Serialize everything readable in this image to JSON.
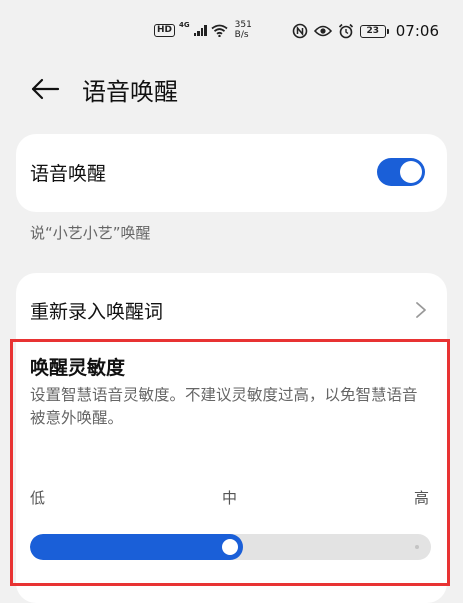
{
  "status_bar": {
    "hd": "HD",
    "network": "4G",
    "speed_value": "351",
    "speed_unit": "B/s",
    "battery": "23",
    "time": "07:06"
  },
  "header": {
    "title": "语音唤醒"
  },
  "voice_wake": {
    "label": "语音唤醒",
    "enabled": true
  },
  "caption": "说“小艺小艺”唤醒",
  "settings": {
    "re_enroll_label": "重新录入唤醒词",
    "sensitivity": {
      "title": "唤醒灵敏度",
      "description": "设置智慧语音灵敏度。不建议灵敏度过高，以免智慧语音被意外唤醒。",
      "low_label": "低",
      "mid_label": "中",
      "high_label": "高",
      "level": 0.5
    }
  },
  "accent_color": "#1a5fd8",
  "highlight_color": "#e83333"
}
